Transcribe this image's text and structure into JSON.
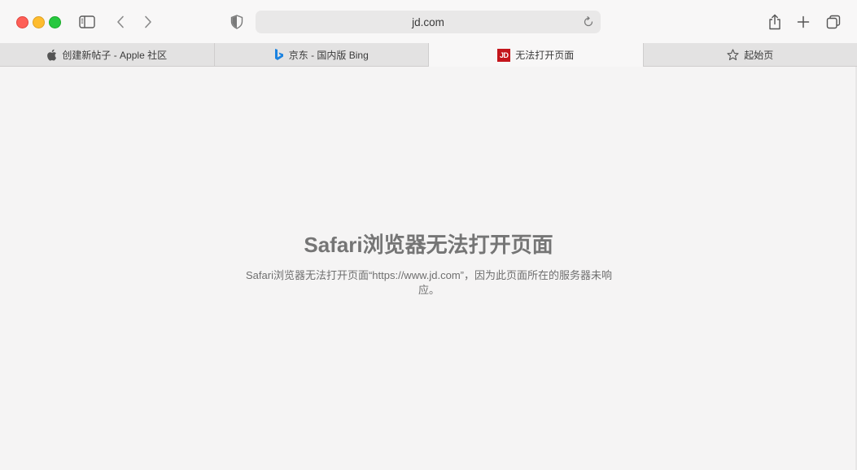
{
  "window": {
    "title": "无法打开页面"
  },
  "toolbar": {
    "address": "jd.com",
    "icons": {
      "sidebar": "sidebar-icon",
      "back": "chevron-left-icon",
      "forward": "chevron-right-icon",
      "privacy": "shield-icon",
      "reload": "reload-icon",
      "share": "share-icon",
      "new_tab": "plus-icon",
      "tab_overview": "tabs-icon"
    }
  },
  "tabs": [
    {
      "label": "创建新帖子 - Apple 社区",
      "icon": "apple-icon",
      "active": false
    },
    {
      "label": "京东 - 国内版 Bing",
      "icon": "bing-icon",
      "active": false
    },
    {
      "label": "无法打开页面",
      "icon": "jd-icon",
      "badge": "JD",
      "active": true
    },
    {
      "label": "起始页",
      "icon": "star-icon",
      "active": false
    }
  ],
  "error": {
    "title": "Safari浏览器无法打开页面",
    "message": "Safari浏览器无法打开页面“https://www.jd.com”，因为此页面所在的服务器未响应。"
  },
  "colors": {
    "close": "#fe5f57",
    "minimize": "#febc2e",
    "maximize": "#28c840",
    "jd_brand": "#c4161c",
    "bing_blue": "#1a82e0"
  }
}
